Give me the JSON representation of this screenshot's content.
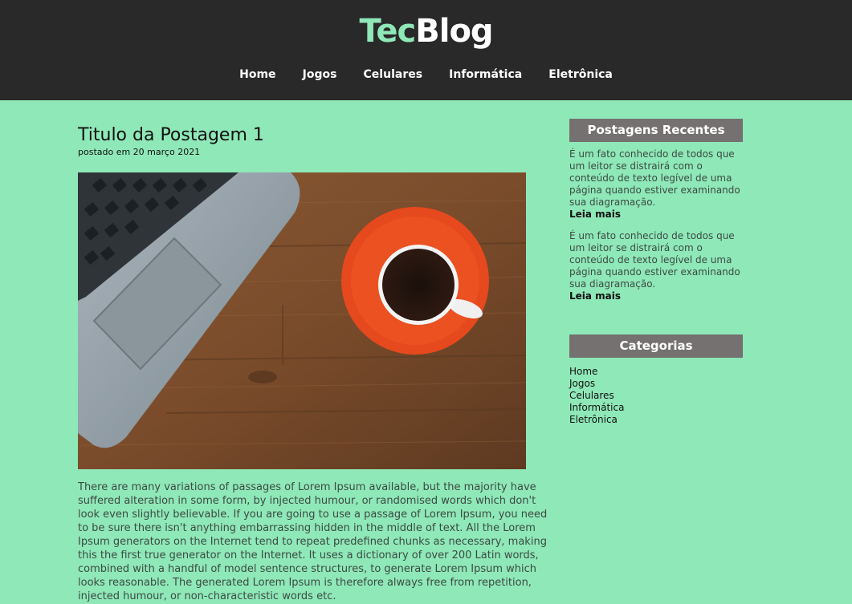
{
  "header": {
    "logo_part1": "Tec",
    "logo_part2": "Blog",
    "nav": [
      "Home",
      "Jogos",
      "Celulares",
      "Informática",
      "Eletrônica"
    ]
  },
  "post": {
    "title": "Titulo da Postagem 1",
    "meta": "postado em 20 março 2021",
    "image_alt": "laptop and coffee cup on wooden table",
    "body": "There are many variations of passages of Lorem Ipsum available, but the majority have suffered alteration in some form, by injected humour, or randomised words which don't look even slightly believable. If you are going to use a passage of Lorem Ipsum, you need to be sure there isn't anything embarrassing hidden in the middle of text. All the Lorem Ipsum generators on the Internet tend to repeat predefined chunks as necessary, making this the first true generator on the Internet. It uses a dictionary of over 200 Latin words, combined with a handful of model sentence structures, to generate Lorem Ipsum which looks reasonable. The generated Lorem Ipsum is therefore always free from repetition, injected humour, or non-characteristic words etc."
  },
  "sidebar": {
    "recent_title": "Postagens Recentes",
    "recent": [
      {
        "text": "É um fato conhecido de todos que um leitor se distrairá com o conteúdo de texto legível de uma página quando estiver examinando sua diagramação.",
        "more": "Leia mais"
      },
      {
        "text": "É um fato conhecido de todos que um leitor se distrairá com o conteúdo de texto legível de uma página quando estiver examinando sua diagramação.",
        "more": "Leia mais"
      }
    ],
    "categories_title": "Categorias",
    "categories": [
      "Home",
      "Jogos",
      "Celulares",
      "Informática",
      "Eletrônica"
    ]
  },
  "colors": {
    "background": "#8fe8b8",
    "header": "#292929",
    "accent": "#8fe8b8",
    "widget_title": "#747170"
  }
}
